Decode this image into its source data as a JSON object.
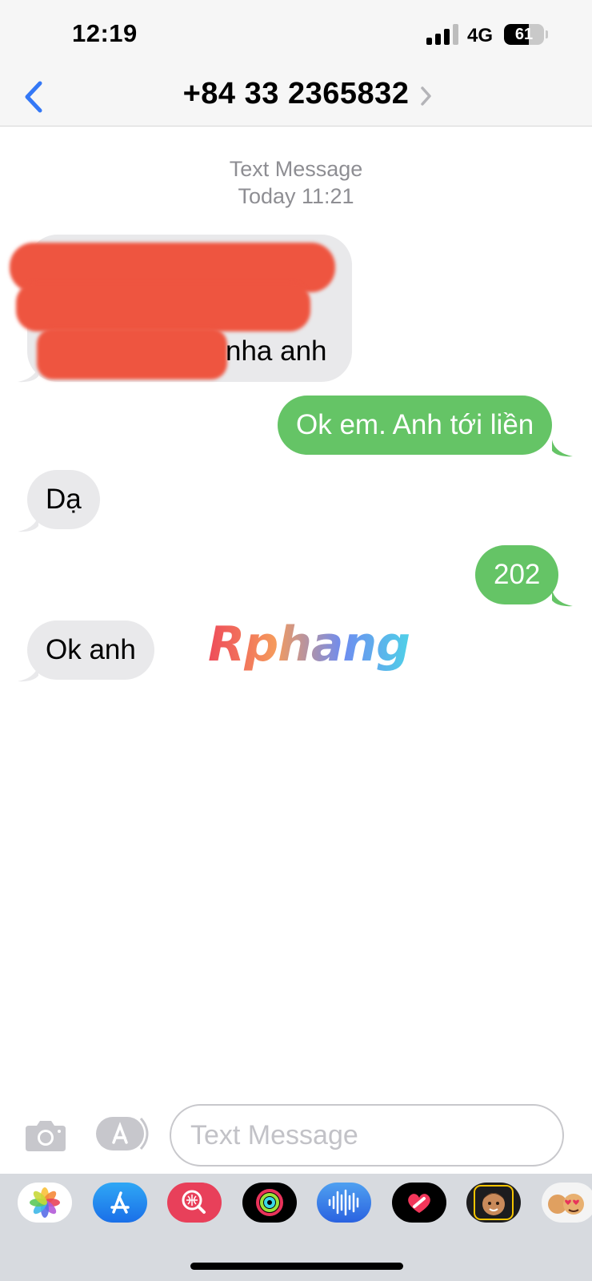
{
  "status_bar": {
    "time": "12:19",
    "network": "4G",
    "battery": "61",
    "battery_level": 0.61
  },
  "header": {
    "title": "+84 33 2365832"
  },
  "conversation": {
    "service": "Text Message",
    "timestamp": "Today 11:21",
    "messages": [
      {
        "direction": "incoming",
        "text": "nha anh",
        "redacted": true
      },
      {
        "direction": "outgoing",
        "text": "Ok em. Anh tới liền"
      },
      {
        "direction": "incoming",
        "text": "Dạ"
      },
      {
        "direction": "outgoing",
        "text": "202"
      },
      {
        "direction": "incoming",
        "text": "Ok anh"
      }
    ]
  },
  "watermark": {
    "text": "Rphang"
  },
  "input_bar": {
    "placeholder": "Text Message"
  },
  "app_drawer": {
    "apps": [
      "photos-app-icon",
      "app-store-icon",
      "image-search-icon",
      "fitness-activity-icon",
      "audio-message-icon",
      "digital-touch-heart-icon",
      "memoji-icon",
      "memoji-stickers-icon"
    ]
  },
  "colors": {
    "outgoing_bubble": "#65c466",
    "incoming_bubble": "#e9e9eb",
    "accent": "#3478f6"
  }
}
